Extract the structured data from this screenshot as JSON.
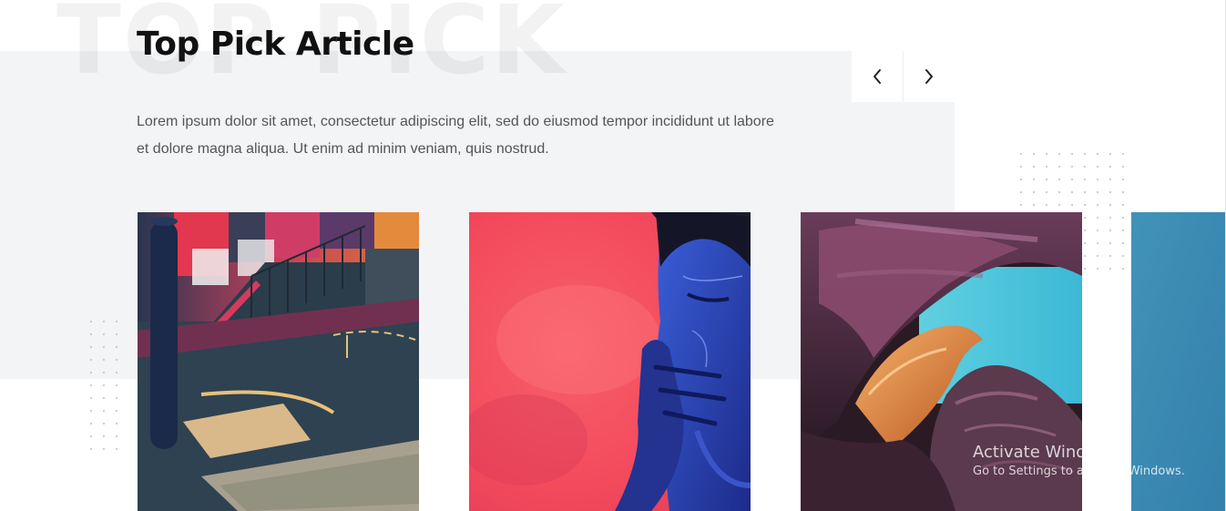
{
  "section": {
    "background_word": "TOP PICK",
    "title": "Top Pick Article",
    "description": "Lorem ipsum dolor sit amet, consectetur adipiscing elit, sed do eiusmod tempor incididunt ut labore et dolore magna aliqua. Ut enim ad minim veniam, quis nostrud."
  },
  "carousel": {
    "prev_icon": "chevron-left-icon",
    "next_icon": "chevron-right-icon",
    "items": [
      {
        "image": "basketball-court-photo"
      },
      {
        "image": "blue-painted-face-portrait-photo"
      },
      {
        "image": "canyon-rock-formation-photo"
      },
      {
        "image": "partial-blue-sky-photo"
      }
    ]
  },
  "watermark": {
    "title": "Activate Windows",
    "subtitle": "Go to Settings to activate Windows."
  },
  "colors": {
    "band": "#f3f4f6",
    "title": "#111111",
    "text": "#555555"
  }
}
